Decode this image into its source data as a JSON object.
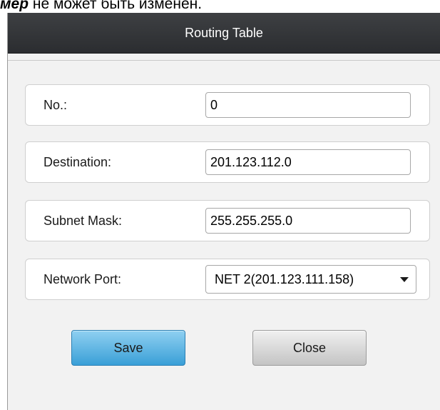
{
  "page_caption": {
    "emphasis": "мер",
    "rest": " не может быть изменен."
  },
  "dialog": {
    "title": "Routing Table"
  },
  "form": {
    "no_label": "No.:",
    "no_value": "0",
    "destination_label": "Destination:",
    "destination_value": "201.123.112.0",
    "subnet_mask_label": "Subnet Mask:",
    "subnet_mask_value": "255.255.255.0",
    "network_port_label": "Network Port:",
    "network_port_value": "NET 2(201.123.111.158)"
  },
  "buttons": {
    "save_label": "Save",
    "close_label": "Close"
  },
  "colors": {
    "titlebar": "#2b2d30",
    "save_button": "#3a9fd7",
    "close_button": "#c4c4c4"
  }
}
